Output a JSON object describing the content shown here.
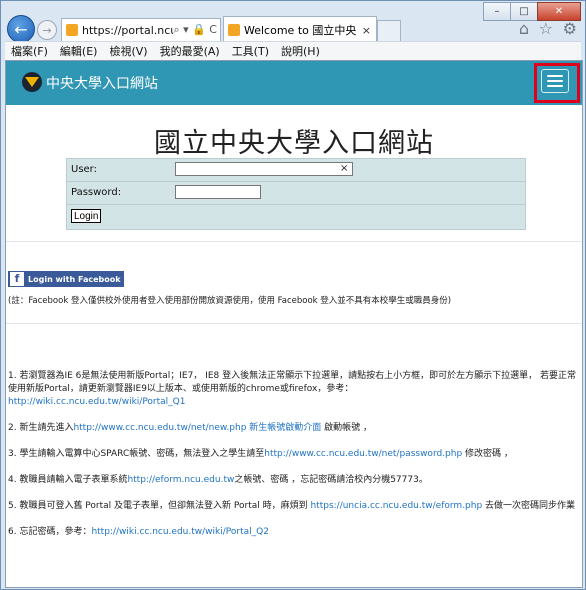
{
  "browser": {
    "address": "https://portal.ncu....",
    "address_tools": "⌕ ▾ 🔒 C",
    "tab_title": "Welcome to 國立中央大學...",
    "tab_close": "×",
    "menu": [
      "檔案(F)",
      "編輯(E)",
      "檢視(V)",
      "我的最愛(A)",
      "工具(T)",
      "說明(H)"
    ]
  },
  "nav": {
    "brand": "中央大學入口網站"
  },
  "page": {
    "title": "國立中央大學入口網站"
  },
  "login": {
    "user_label": "User:",
    "password_label": "Password:",
    "user_value": "",
    "password_value": "",
    "clear": "×",
    "button": "Login"
  },
  "facebook": {
    "button": "Login with Facebook",
    "note": "(註：Facebook 登入僅供校外使用者登入使用部份開放資源使用，使用 Facebook 登入並不具有本校學生或職員身份)"
  },
  "items": {
    "i1_text": "1. 若瀏覽器為IE 6是無法使用新版Portal；IE7， IE8 登入後無法正常顯示下拉選單，請點按右上小方框，即可於左方顯示下拉選單， 若要正常使用新版Portal，請更新瀏覽器IE9以上版本、或使用新版的chrome或firefox，參考：",
    "i1_link": "http://wiki.cc.ncu.edu.tw/wiki/Portal_Q1",
    "i2_pre": "2. 新生請先進入",
    "i2_link": "http://www.cc.ncu.edu.tw/net/new.php 新生帳號啟動介面",
    "i2_post": " 啟動帳號 ，",
    "i3_pre": "3. 學生請輸入電算中心SPARC帳號、密碼，無法登入之學生請至",
    "i3_link": "http://www.cc.ncu.edu.tw/net/password.php",
    "i3_post": " 修改密碼 ，",
    "i4_pre": "4. 教職員請輸入電子表單系統",
    "i4_link": "http://eform.ncu.edu.tw",
    "i4_post": "之帳號、密碼 ，忘記密碼請洽校內分機57773。",
    "i5_pre": "5. 教職員可登入舊 Portal 及電子表單，但卻無法登入新 Portal 時，麻煩到 ",
    "i5_link": "https://uncia.cc.ncu.edu.tw/eform.php",
    "i5_post": " 去做一次密碼同步作業",
    "i6_pre": "6. 忘記密碼，參考：",
    "i6_link": "http://wiki.cc.ncu.edu.tw/wiki/Portal_Q2"
  },
  "colors": {
    "navbar": "#2f96b4",
    "highlight": "#e0001b",
    "link": "#1f73c4",
    "login_bg": "#d3e4e6",
    "facebook": "#3b5a99"
  }
}
